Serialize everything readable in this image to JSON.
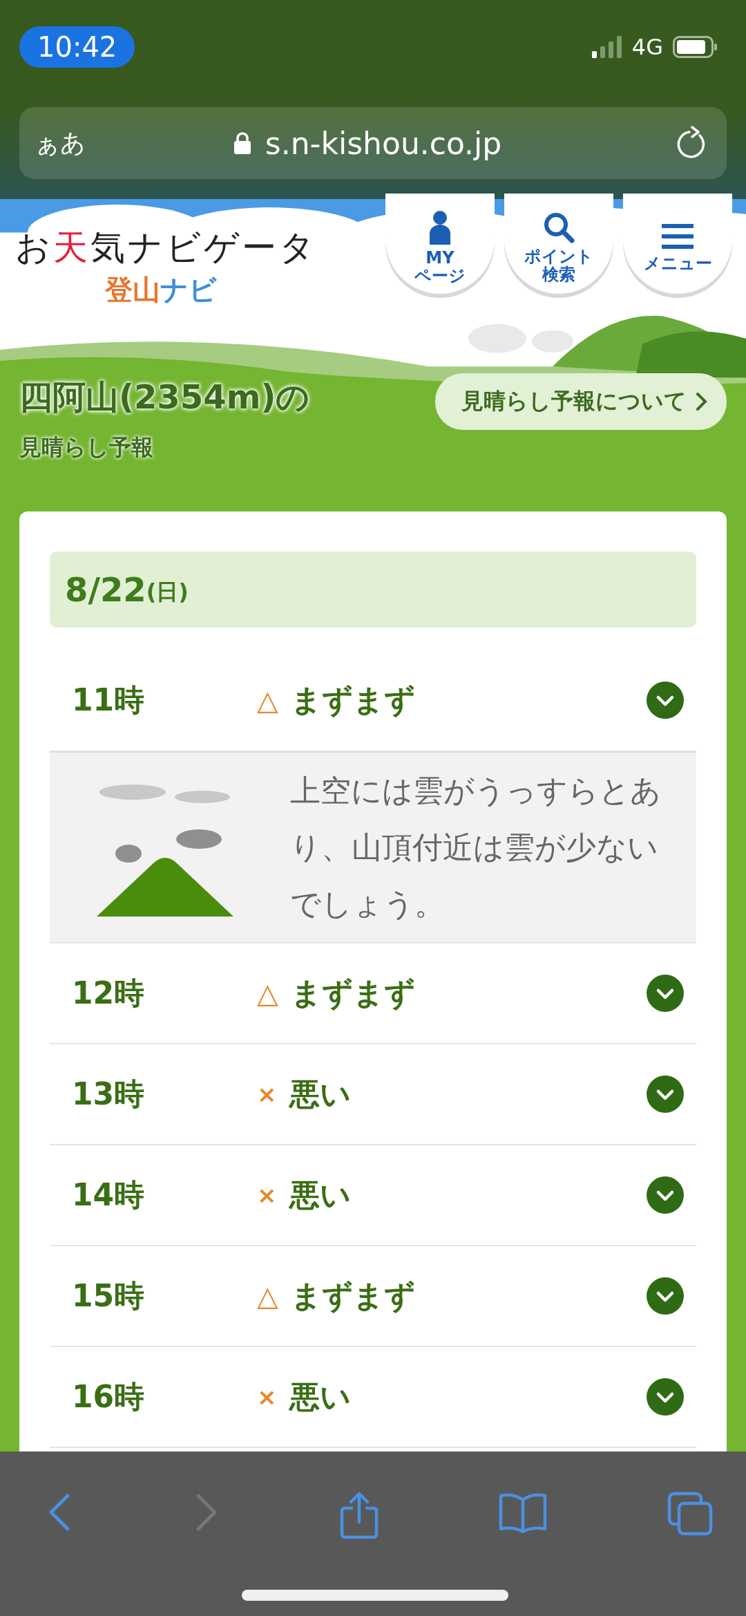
{
  "status_bar": {
    "time": "10:42",
    "network": "4G"
  },
  "browser": {
    "text_size_button": "ぁあ",
    "url": "s.n-kishou.co.jp"
  },
  "header": {
    "logo_parts": [
      {
        "text": "お",
        "accent": false
      },
      {
        "text": "天",
        "accent": true
      },
      {
        "text": "気ナビゲータ",
        "accent": false
      }
    ],
    "sublogo_parts": [
      {
        "text": "登山",
        "color": "#e8762c"
      },
      {
        "text": "ナビ",
        "color": "#3f8fd8"
      }
    ],
    "buttons": [
      {
        "kind": "person",
        "lines": [
          "MY",
          "ページ"
        ]
      },
      {
        "kind": "search",
        "lines": [
          "ポイント",
          "検索"
        ]
      },
      {
        "kind": "menu",
        "lines": [
          "メニュー"
        ]
      }
    ]
  },
  "banner": {
    "title": "四阿山(2354m)の",
    "subtitle": "見晴らし予報",
    "about_link": "見晴らし予報について"
  },
  "forecast": {
    "date": "8/22",
    "weekday": "(日)",
    "rows": [
      {
        "time": "11時",
        "kind": "fair",
        "mark": "△",
        "rating": "まずまず",
        "expanded": true,
        "detail": "上空には雲がうっすらとあり、山頂付近は雲が少ないでしょう。"
      },
      {
        "time": "12時",
        "kind": "fair",
        "mark": "△",
        "rating": "まずまず",
        "expanded": false
      },
      {
        "time": "13時",
        "kind": "bad",
        "mark": "×",
        "rating": "悪い",
        "expanded": false
      },
      {
        "time": "14時",
        "kind": "bad",
        "mark": "×",
        "rating": "悪い",
        "expanded": false
      },
      {
        "time": "15時",
        "kind": "fair",
        "mark": "△",
        "rating": "まずまず",
        "expanded": false
      },
      {
        "time": "16時",
        "kind": "bad",
        "mark": "×",
        "rating": "悪い",
        "expanded": false
      }
    ]
  },
  "toolbar": {
    "back_disabled": false,
    "forward_disabled": true
  }
}
